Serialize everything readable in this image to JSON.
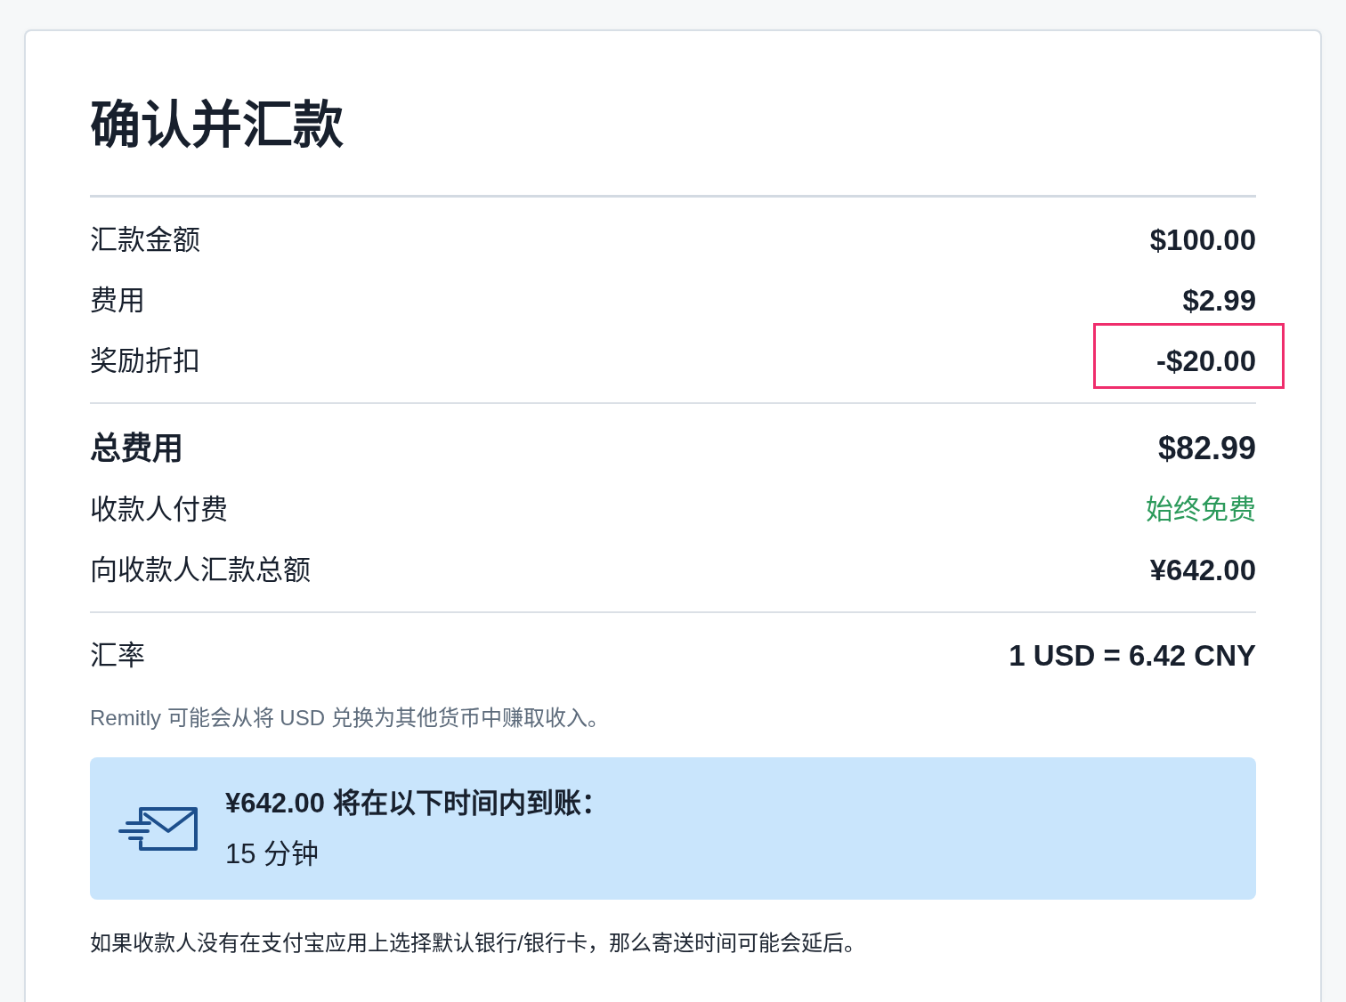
{
  "title": "确认并汇款",
  "sections": [
    {
      "rows": [
        {
          "kind": "amount",
          "label": "汇款金额",
          "value": "$100.00",
          "highlighted": false
        },
        {
          "kind": "amount",
          "label": "费用",
          "value": "$2.99",
          "highlighted": false
        },
        {
          "kind": "amount",
          "label": "奖励折扣",
          "value": "-$20.00",
          "highlighted": true
        }
      ]
    },
    {
      "rows": [
        {
          "kind": "total",
          "label": "总费用",
          "value": "$82.99",
          "highlighted": false
        },
        {
          "kind": "free",
          "label": "收款人付费",
          "value": "始终免费",
          "highlighted": false
        },
        {
          "kind": "amount",
          "label": "向收款人汇款总额",
          "value": "¥642.00",
          "highlighted": false
        }
      ]
    },
    {
      "rows": [
        {
          "kind": "amount",
          "label": "汇率",
          "value": "1 USD = 6.42 CNY",
          "highlighted": false
        }
      ],
      "note": "Remitly 可能会从将 USD 兑换为其他货币中赚取收入。"
    }
  ],
  "delivery": {
    "heading": "¥642.00 将在以下时间内到账：",
    "duration": "15 分钟"
  },
  "notice": "如果收款人没有在支付宝应用上选择默认银行/银行卡，那么寄送时间可能会延后。"
}
